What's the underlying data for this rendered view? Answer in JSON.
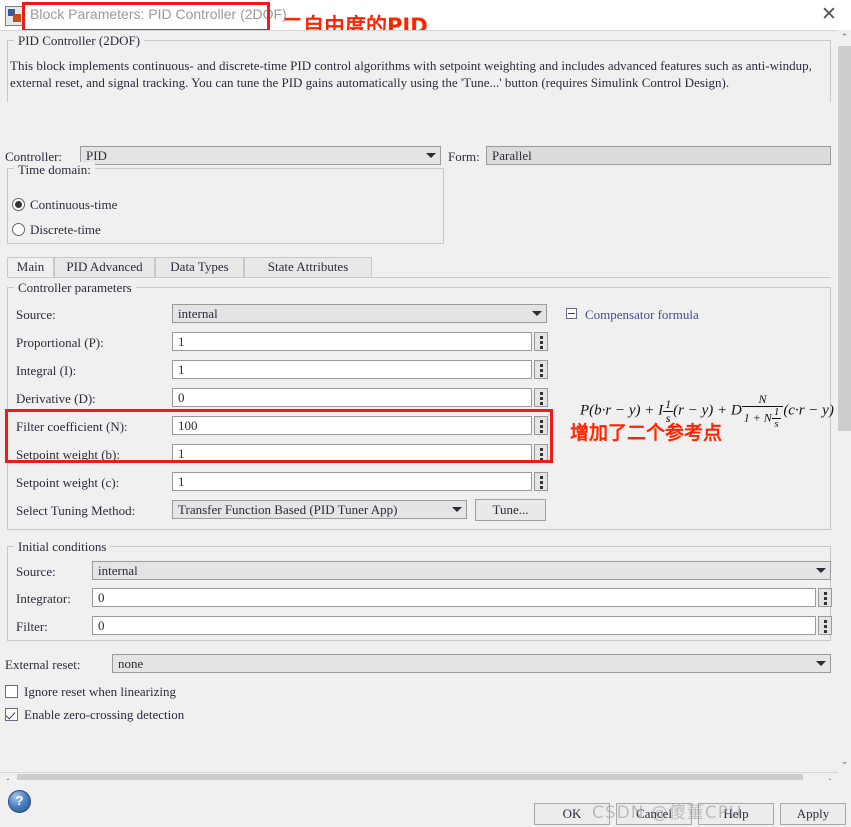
{
  "window": {
    "title": "Block Parameters: PID Controller (2DOF)",
    "close_label": "✕",
    "app_icon": "simulink-block-icon"
  },
  "annotations": {
    "title_note": "二自由度的PID",
    "setpoint_note": "增加了二个参考点",
    "watermark": "CSDN @傻董CPU"
  },
  "description": {
    "group_label": "PID Controller (2DOF)",
    "body": "This block implements continuous- and discrete-time PID control algorithms with setpoint weighting and includes advanced features such as anti-windup, external reset, and signal tracking. You can tune the PID gains automatically using the 'Tune...' button (requires Simulink Control Design)."
  },
  "controller_row": {
    "controller_label": "Controller:",
    "controller_value": "PID",
    "form_label": "Form:",
    "form_value": "Parallel"
  },
  "time_domain": {
    "group_label": "Time domain:",
    "options": [
      {
        "label": "Continuous-time",
        "selected": true
      },
      {
        "label": "Discrete-time",
        "selected": false
      }
    ]
  },
  "tabs": [
    {
      "label": "Main",
      "selected": true
    },
    {
      "label": "PID Advanced",
      "selected": false
    },
    {
      "label": "Data Types",
      "selected": false
    },
    {
      "label": "State Attributes",
      "selected": false
    }
  ],
  "controller_parameters": {
    "group_label": "Controller parameters",
    "source_label": "Source:",
    "source_value": "internal",
    "fields": [
      {
        "label": "Proportional (P):",
        "value": "1"
      },
      {
        "label": "Integral (I):",
        "value": "1"
      },
      {
        "label": "Derivative (D):",
        "value": "0"
      },
      {
        "label": "Filter coefficient (N):",
        "value": "100"
      },
      {
        "label": "Setpoint weight (b):",
        "value": "1"
      },
      {
        "label": "Setpoint weight (c):",
        "value": "1"
      }
    ],
    "tuning_label": "Select Tuning Method:",
    "tuning_value": "Transfer Function Based (PID Tuner App)",
    "tune_button": "Tune..."
  },
  "compensator": {
    "title": "Compensator formula",
    "toggle_icon": "collapse-minus-icon",
    "formula_parts": {
      "p_term": "P(b·r − y) + I",
      "i_frac_num": "1",
      "i_frac_den": "s",
      "i_tail": "(r − y) + D",
      "d_num": "N",
      "d_den_prefix": "1 + N",
      "d_den_num": "1",
      "d_den_den": "s",
      "c_term": "(c·r − y)"
    }
  },
  "initial_conditions": {
    "group_label": "Initial conditions",
    "source_label": "Source:",
    "source_value": "internal",
    "fields": [
      {
        "label": "Integrator:",
        "value": "0"
      },
      {
        "label": "Filter:",
        "value": "0"
      }
    ]
  },
  "external_reset": {
    "label": "External reset:",
    "value": "none"
  },
  "checkboxes": [
    {
      "label": "Ignore reset when linearizing",
      "checked": false
    },
    {
      "label": "Enable zero-crossing detection",
      "checked": true
    }
  ],
  "footer": {
    "help_icon": "help-question-icon",
    "buttons": [
      {
        "label": "OK"
      },
      {
        "label": "Cancel"
      },
      {
        "label": "Help"
      },
      {
        "label": "Apply"
      }
    ]
  },
  "scrollbars": {
    "v_up": "⌃",
    "v_down": "⌄",
    "h_left": "‹",
    "h_right": "›"
  }
}
